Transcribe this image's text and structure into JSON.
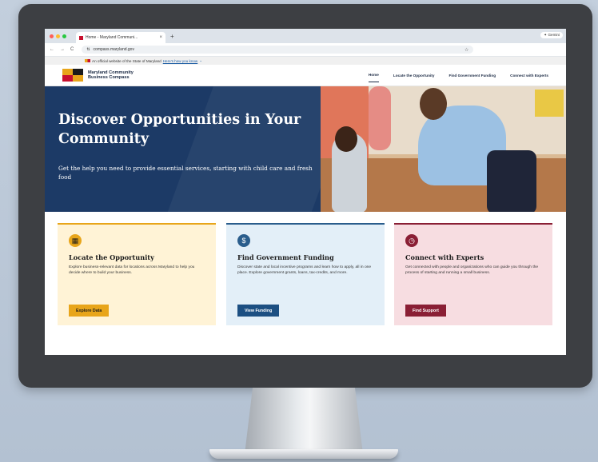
{
  "browser": {
    "tab_title": "Home - Maryland Communi...",
    "tab_close": "×",
    "new_tab": "+",
    "profile": "Gemini",
    "url": "compass.maryland.gov",
    "nav_back": "←",
    "nav_forward": "→",
    "nav_reload": "C",
    "traffic_lights": [
      "#ff5f57",
      "#febc2e",
      "#28c840"
    ]
  },
  "official_banner": {
    "text": "An official website of the State of Maryland",
    "link": "Here's how you know"
  },
  "site": {
    "brand_line1": "Maryland Community",
    "brand_line2": "Business Compass",
    "nav": [
      {
        "label": "Home",
        "active": true
      },
      {
        "label": "Locate the Opportunity"
      },
      {
        "label": "Find Government Funding"
      },
      {
        "label": "Connect with Experts"
      }
    ]
  },
  "hero": {
    "title": "Discover Opportunities in Your Community",
    "subtitle": "Get the help you need to provide essential services, starting with child care and fresh food"
  },
  "cards": [
    {
      "icon": "map-icon",
      "title": "Locate the Opportunity",
      "body": "Explore business-relevant data for locations across Maryland to help you decide where to build your business.",
      "button": "Explore Data",
      "accent": "#e8a51a"
    },
    {
      "icon": "dollar-icon",
      "title": "Find Government Funding",
      "body": "Discover state and local incentive programs and learn how to apply, all in one place. Explore government grants, loans, tax-credits, and more.",
      "button": "View Funding",
      "accent": "#2a5d8c"
    },
    {
      "icon": "clock-icon",
      "title": "Connect with Experts",
      "body": "Get connected with people and organizations who can guide you through the process of starting and running a small business.",
      "button": "Find Support",
      "accent": "#8a1f35"
    }
  ]
}
